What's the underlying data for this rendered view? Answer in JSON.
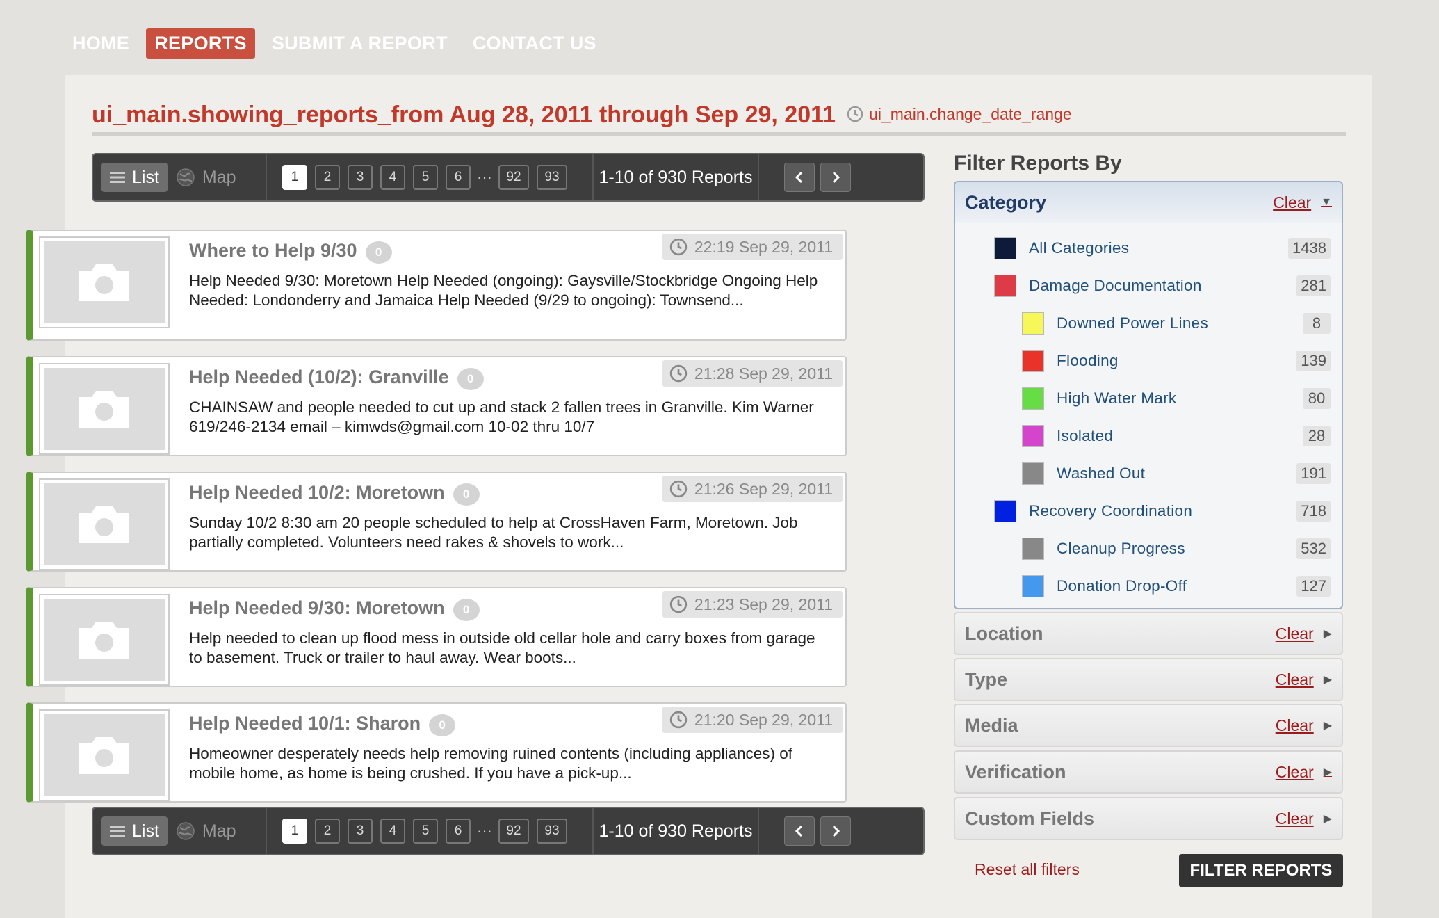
{
  "nav": {
    "items": [
      "HOME",
      "REPORTS",
      "SUBMIT A REPORT",
      "CONTACT US"
    ],
    "active_index": 1
  },
  "header": {
    "title": "ui_main.showing_reports_from Aug 28, 2011 through Sep 29, 2011",
    "change_range": "ui_main.change_date_range"
  },
  "pager": {
    "list_label": "List",
    "map_label": "Map",
    "pages": [
      "1",
      "2",
      "3",
      "4",
      "5",
      "6"
    ],
    "ellipsis": "···",
    "last_pages": [
      "92",
      "93"
    ],
    "current": "1",
    "count": "1-10 of 930 Reports"
  },
  "reports": [
    {
      "title": "Where to Help 9/30",
      "comments": "0",
      "date": "22:19 Sep 29, 2011",
      "text": "Help Needed 9/30: Moretown Help Needed (ongoing): Gaysville/Stockbridge Ongoing Help Needed: Londonderry and Jamaica Help Needed (9/29 to ongoing): Townsend..."
    },
    {
      "title": "Help Needed (10/2): Granville",
      "comments": "0",
      "date": "21:28 Sep 29, 2011",
      "text": "CHAINSAW and people needed to cut up and stack 2 fallen trees in Granville. Kim Warner 619/246-2134 email – kimwds@gmail.com 10-02 thru 10/7"
    },
    {
      "title": "Help Needed 10/2: Moretown",
      "comments": "0",
      "date": "21:26 Sep 29, 2011",
      "text": "Sunday 10/2 8:30 am 20 people scheduled to help at CrossHaven Farm, Moretown. Job partially completed. Volunteers need rakes & shovels to work..."
    },
    {
      "title": "Help Needed 9/30: Moretown",
      "comments": "0",
      "date": "21:23 Sep 29, 2011",
      "text": "Help needed to clean up flood mess in outside old cellar hole and carry boxes from garage to basement. Truck or trailer to haul away. Wear boots..."
    },
    {
      "title": "Help Needed 10/1: Sharon",
      "comments": "0",
      "date": "21:20 Sep 29, 2011",
      "text": "Homeowner desperately needs help removing ruined contents (including appliances) of mobile home, as home is being crushed. If you have a pick-up..."
    }
  ],
  "filters": {
    "title": "Filter Reports By",
    "clear_label": "Clear",
    "category_title": "Category",
    "categories": [
      {
        "name": "All Categories",
        "count": "1438",
        "color": "#0d1a3a",
        "sub": false
      },
      {
        "name": "Damage Documentation",
        "count": "281",
        "color": "#dd3b45",
        "sub": false
      },
      {
        "name": "Downed Power Lines",
        "count": "8",
        "color": "#f7f75a",
        "sub": true
      },
      {
        "name": "Flooding",
        "count": "139",
        "color": "#e8322a",
        "sub": true
      },
      {
        "name": "High Water Mark",
        "count": "80",
        "color": "#66dd44",
        "sub": true
      },
      {
        "name": "Isolated",
        "count": "28",
        "color": "#d444cc",
        "sub": true
      },
      {
        "name": "Washed Out",
        "count": "191",
        "color": "#888888",
        "sub": true
      },
      {
        "name": "Recovery Coordination",
        "count": "718",
        "color": "#0022e0",
        "sub": false
      },
      {
        "name": "Cleanup Progress",
        "count": "532",
        "color": "#888888",
        "sub": true
      },
      {
        "name": "Donation Drop-Off",
        "count": "127",
        "color": "#4499ee",
        "sub": true
      },
      {
        "name": "",
        "count": "",
        "color": "#0022e0",
        "sub": true
      }
    ],
    "sections": [
      "Location",
      "Type",
      "Media",
      "Verification",
      "Custom Fields"
    ],
    "reset_label": "Reset all filters",
    "submit_label": "FILTER REPORTS"
  }
}
